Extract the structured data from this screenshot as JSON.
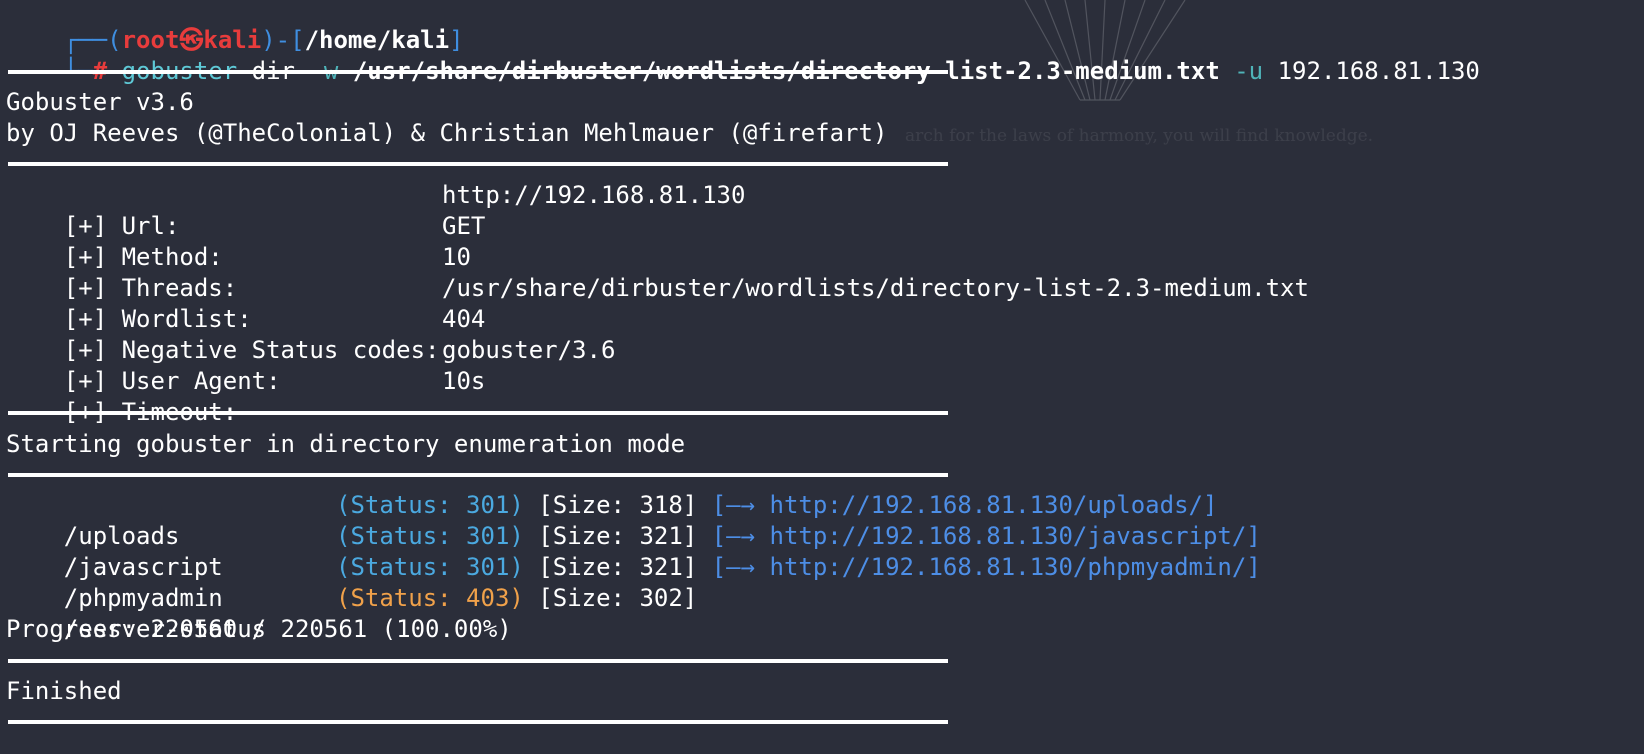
{
  "prompt": {
    "box_top": "┌──",
    "box_bottom": "└─",
    "open_paren": "(",
    "user": "root",
    "at_symbol": "㉿",
    "host": "kali",
    "close_paren": ")",
    "dash_bracket": "-[",
    "path": "/home/kali",
    "close_bracket": "]",
    "hash": "#"
  },
  "command": {
    "program": "gobuster",
    "subcommand": "dir",
    "wordlist_flag": "-w",
    "wordlist_path": "/usr/share/dirbuster/wordlists/directory-list-2.3-medium.txt",
    "url_flag": "-u",
    "target": "192.168.81.130"
  },
  "banner": {
    "version_line": "Gobuster v3.6",
    "author_line": "by OJ Reeves (@TheColonial) & Christian Mehlmauer (@firefart)"
  },
  "config": [
    {
      "label": "[+] Url:",
      "value": "http://192.168.81.130"
    },
    {
      "label": "[+] Method:",
      "value": "GET"
    },
    {
      "label": "[+] Threads:",
      "value": "10"
    },
    {
      "label": "[+] Wordlist:",
      "value": "/usr/share/dirbuster/wordlists/directory-list-2.3-medium.txt"
    },
    {
      "label": "[+] Negative Status codes:",
      "value": "404"
    },
    {
      "label": "[+] User Agent:",
      "value": "gobuster/3.6"
    },
    {
      "label": "[+] Timeout:",
      "value": "10s"
    }
  ],
  "mode_line": "Starting gobuster in directory enumeration mode",
  "results": [
    {
      "path": "/uploads",
      "status": "(Status: 301)",
      "size": "[Size: 318]",
      "redirect": "[—→ http://192.168.81.130/uploads/]"
    },
    {
      "path": "/javascript",
      "status": "(Status: 301)",
      "size": "[Size: 321]",
      "redirect": "[—→ http://192.168.81.130/javascript/]"
    },
    {
      "path": "/phpmyadmin",
      "status": "(Status: 301)",
      "size": "[Size: 321]",
      "redirect": "[—→ http://192.168.81.130/phpmyadmin/]"
    },
    {
      "path": "/server-status",
      "status": "(Status: 403)",
      "size": "[Size: 302]",
      "redirect": ""
    }
  ],
  "progress_line": "Progress: 220560 / 220561 (100.00%)",
  "finished_line": "Finished",
  "background_caption": "arch for the laws of harmony, you will find knowledge.",
  "colors": {
    "background": "#2b2e3a",
    "prompt_blue": "#3f8ee0",
    "prompt_red": "#e83c3c",
    "command_cyan": "#5ec9d6",
    "status_301": "#4ba9e0",
    "status_403": "#f0a14a",
    "link_blue": "#4d8ee6"
  }
}
